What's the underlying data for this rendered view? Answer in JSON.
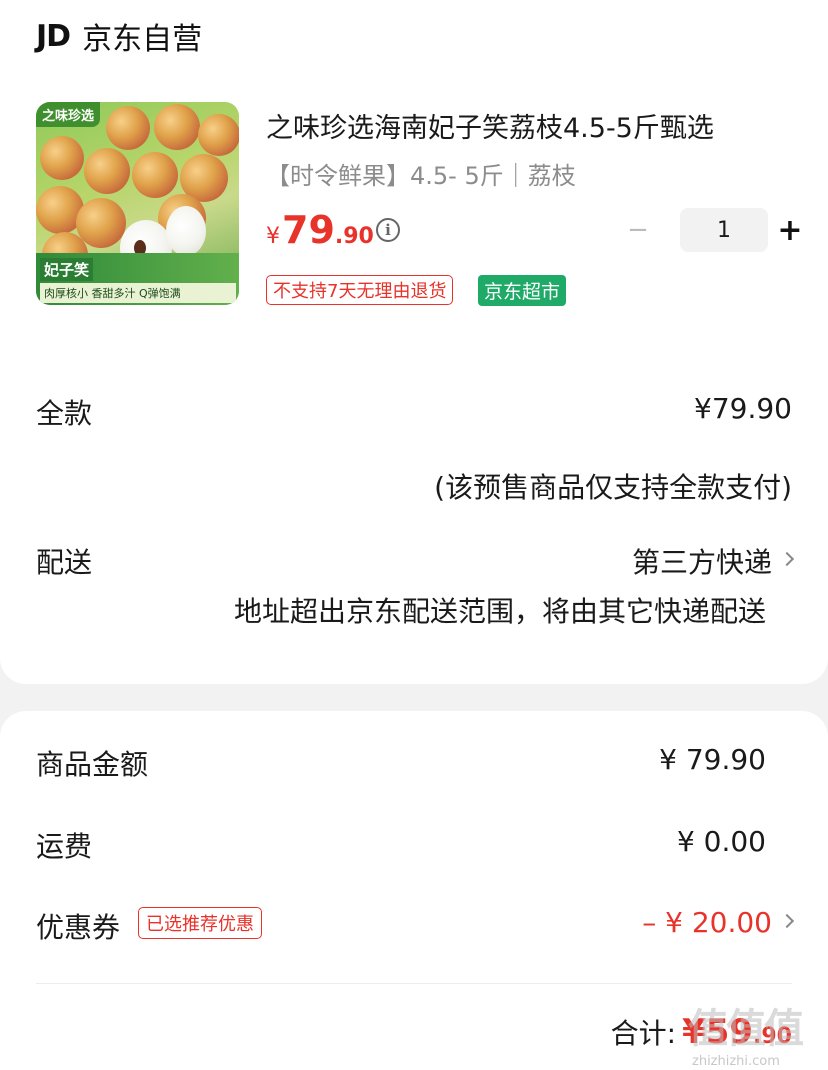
{
  "shop": {
    "logo_text": "JD",
    "name": "京东自营"
  },
  "product": {
    "image": {
      "brand": "之味珍选",
      "banner_title": "妃子笑",
      "banner_name": "荔枝",
      "banner_sub": "肉厚核小 香甜多汁 Q弹饱满"
    },
    "title": "之味珍选海南妃子笑荔枝4.5-5斤甄选",
    "spec": "【时令鲜果】4.5- 5斤｜荔枝",
    "price": {
      "symbol": "¥",
      "integer": "79",
      "decimal": ".90"
    },
    "info_icon": "info-icon",
    "quantity": "1",
    "minus_glyph": "−",
    "plus_glyph": "+",
    "tags": [
      "不支持7天无理由退货",
      "京东超市"
    ]
  },
  "payment": {
    "label": "全款",
    "value": "¥79.90",
    "note": "(该预售商品仅支持全款支付)"
  },
  "delivery": {
    "label": "配送",
    "value": "第三方快递",
    "note": "地址超出京东配送范围，将由其它快递配送"
  },
  "summary": {
    "goods_label": "商品金额",
    "goods_value": "¥ 79.90",
    "shipping_label": "运费",
    "shipping_value": "¥ 0.00",
    "coupon_label": "优惠券",
    "coupon_tag": "已选推荐优惠",
    "coupon_value": "– ¥ 20.00"
  },
  "total": {
    "label": "合计:",
    "amount": "¥59",
    "decimal": ".90"
  },
  "watermark": {
    "glyphs": "值值值",
    "domain": "zhizhizhi.com"
  },
  "colors": {
    "accent": "#e8332a",
    "green_tag": "#1faa68",
    "background": "#f2f2f2"
  }
}
